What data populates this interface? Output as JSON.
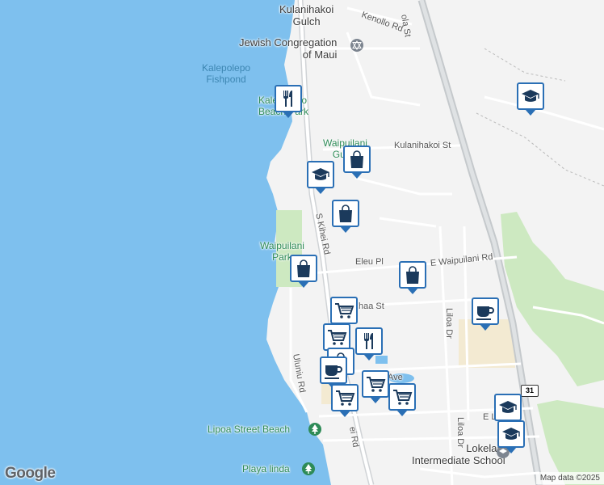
{
  "map": {
    "water_color": "#7ec0ee",
    "land_color": "#f3f3f3",
    "park_color": "#cde9c1",
    "commercial_color": "#f3ead2",
    "highway_color": "#c5c9cc",
    "road_color": "#ffffff"
  },
  "labels": {
    "kulanihakoi_gulch": "Kulanihakoi\nGulch",
    "jewish_congregation": "Jewish Congregation\nof Maui",
    "kalepolepo_fishpond": "Kalepolepo\nFishpond",
    "kalepolepo_beach_park": "Kalepolepo\nBeach Park",
    "waipuilani_gulch": "Waipuilani\nGulch",
    "waipuilani_park": "Waipuilani\nPark",
    "lipoa_street_beach": "Lipoa Street Beach",
    "playa_linda": "Playa linda",
    "lokelani_school": "Lokelani\nIntermediate School"
  },
  "streets": {
    "kenollo_rd": "Kenollo Rd",
    "ola_st": "ola St",
    "kulanihakoi_st": "Kulanihakoi St",
    "s_kihei_rd": "S Kihei Rd",
    "eleu_pl": "Eleu Pl",
    "e_waipuilani_rd": "E Waipuilani Rd",
    "haa_st": "haa St",
    "liloa_dr": "Liloa Dr",
    "liloa_dr_2": "Liloa Dr",
    "uluniu_rd": "Uluniu Rd",
    "ei_rd": "ei Rd",
    "ave": "Ave",
    "e_l": "E L"
  },
  "route_shield": "31",
  "branding": {
    "logo": "Google",
    "attribution": "Map data ©2025"
  },
  "pins": [
    {
      "icon": "restaurant",
      "label": "restaurant"
    },
    {
      "icon": "school",
      "label": "school"
    },
    {
      "icon": "shopping",
      "label": "shopping"
    },
    {
      "icon": "school",
      "label": "school"
    },
    {
      "icon": "shopping",
      "label": "shopping"
    },
    {
      "icon": "shopping",
      "label": "shopping"
    },
    {
      "icon": "shopping",
      "label": "shopping"
    },
    {
      "icon": "grocery",
      "label": "grocery"
    },
    {
      "icon": "cafe",
      "label": "cafe"
    },
    {
      "icon": "grocery",
      "label": "grocery"
    },
    {
      "icon": "restaurant",
      "label": "restaurant"
    },
    {
      "icon": "shopping",
      "label": "shopping"
    },
    {
      "icon": "cafe",
      "label": "cafe"
    },
    {
      "icon": "grocery",
      "label": "grocery"
    },
    {
      "icon": "grocery",
      "label": "grocery"
    },
    {
      "icon": "grocery",
      "label": "grocery"
    },
    {
      "icon": "school",
      "label": "school"
    },
    {
      "icon": "school",
      "label": "school"
    }
  ]
}
